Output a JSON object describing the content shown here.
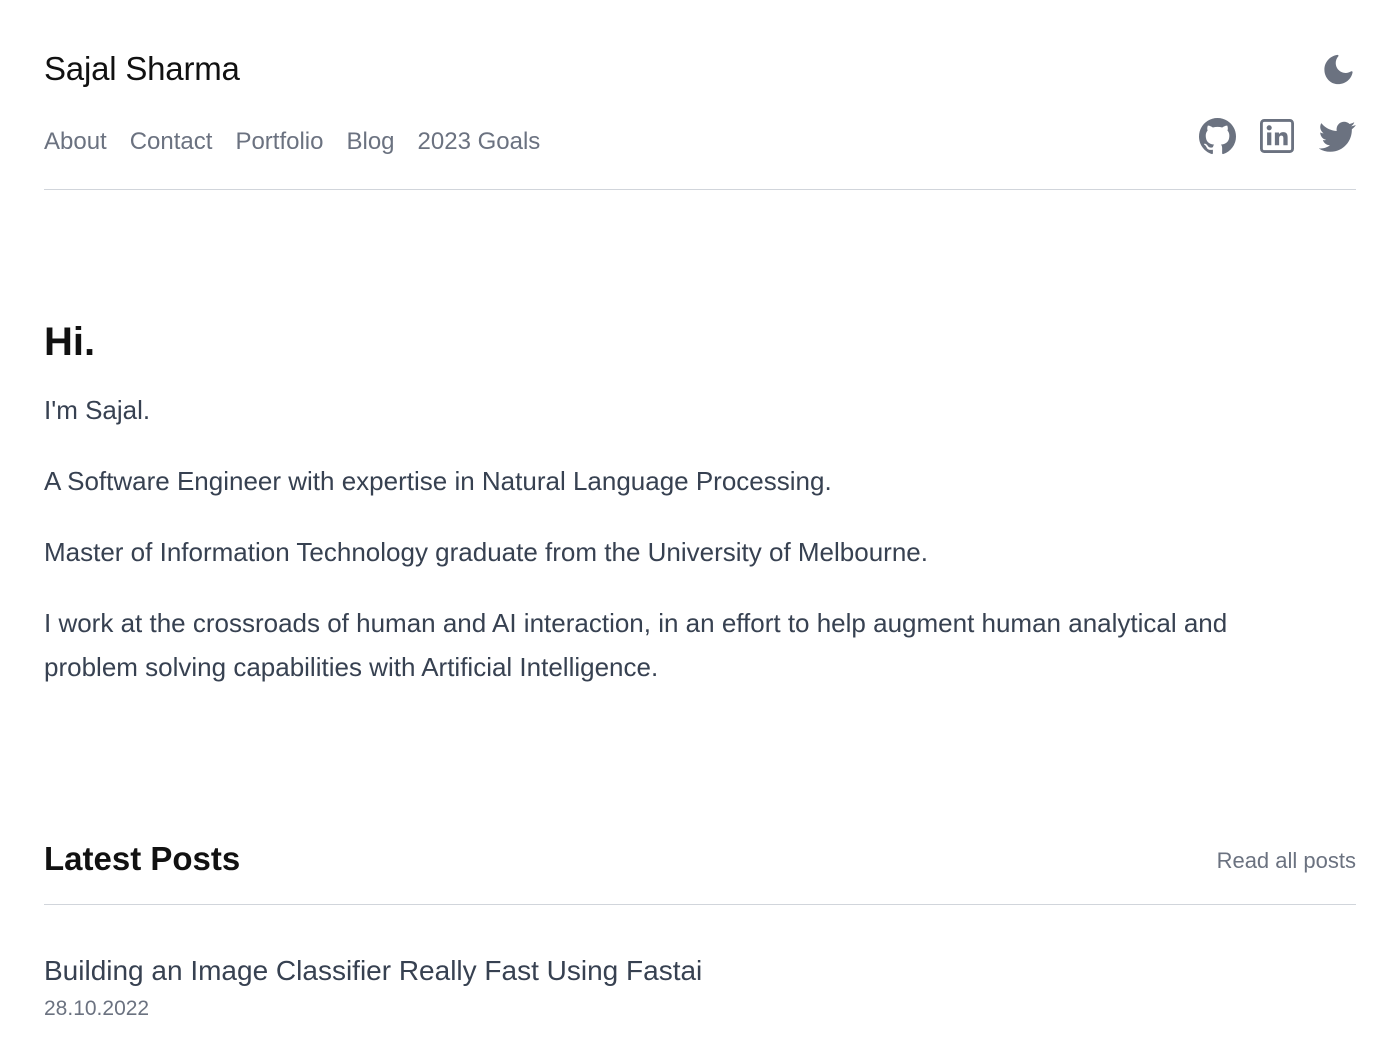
{
  "header": {
    "site_title": "Sajal Sharma",
    "nav": [
      {
        "label": "About"
      },
      {
        "label": "Contact"
      },
      {
        "label": "Portfolio"
      },
      {
        "label": "Blog"
      },
      {
        "label": "2023 Goals"
      }
    ],
    "theme_toggle_icon": "moon-icon",
    "social_icons": [
      "github-icon",
      "linkedin-icon",
      "twitter-icon"
    ]
  },
  "hero": {
    "heading": "Hi.",
    "paragraphs": [
      "I'm Sajal.",
      "A Software Engineer with expertise in Natural Language Processing.",
      "Master of Information Technology graduate from the University of Melbourne.",
      "I work at the crossroads of human and AI interaction, in an effort to help augment human analytical and problem solving capabilities with Artificial Intelligence."
    ]
  },
  "latest_posts": {
    "heading": "Latest Posts",
    "read_all_label": "Read all posts",
    "posts": [
      {
        "title": "Building an Image Classifier Really Fast Using Fastai",
        "date": "28.10.2022"
      }
    ]
  },
  "colors": {
    "text_primary": "#111111",
    "text_body": "#374151",
    "text_muted": "#6b7280",
    "icon": "#6b7280",
    "divider": "#d1d5db",
    "background": "#ffffff"
  }
}
